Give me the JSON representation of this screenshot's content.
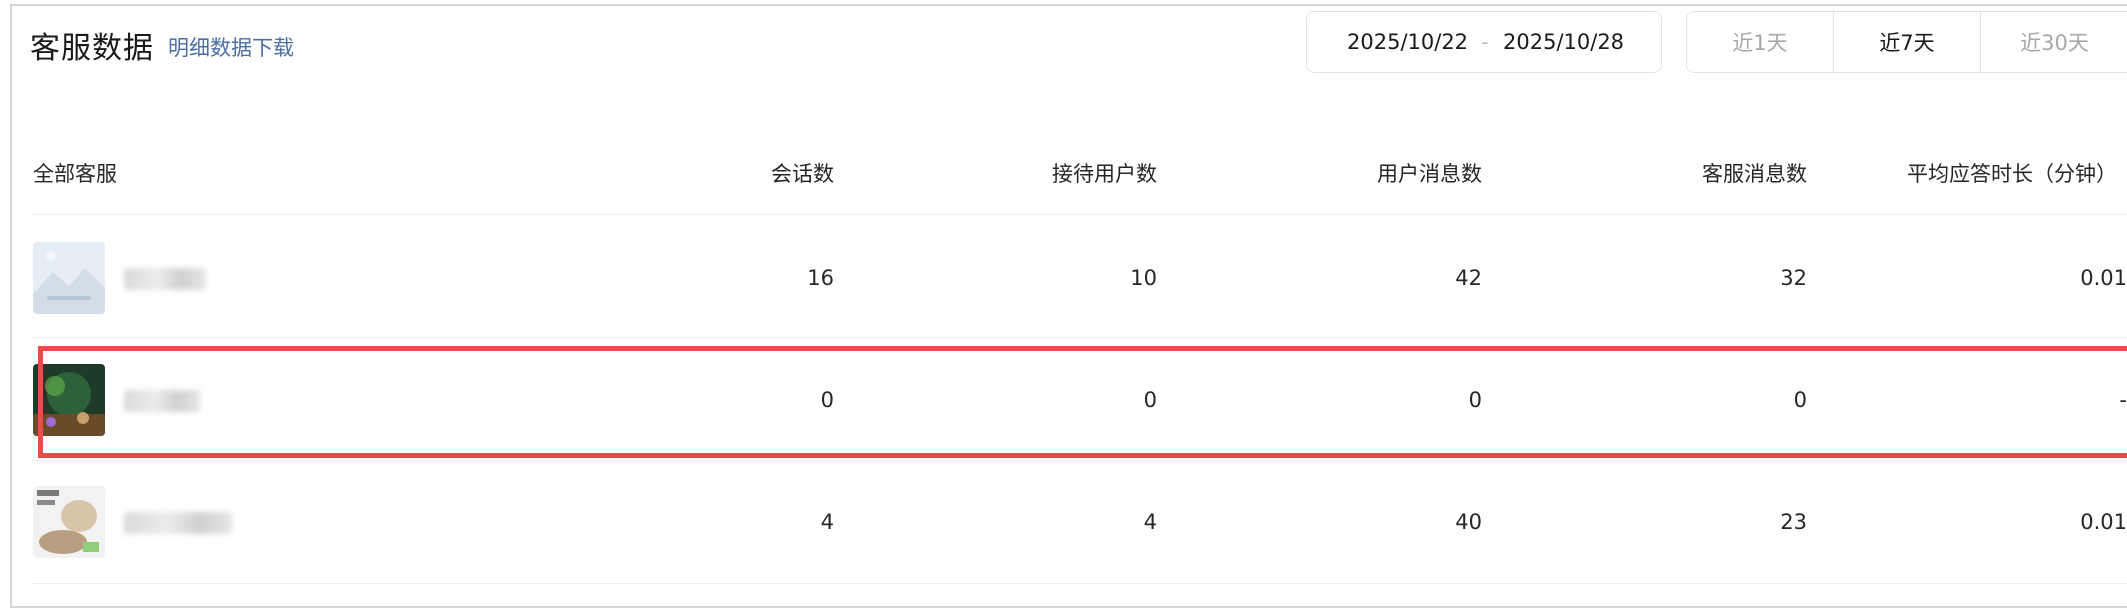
{
  "header": {
    "title": "客服数据",
    "download_link": "明细数据下载"
  },
  "date_range": {
    "start": "2025/10/22",
    "separator": "-",
    "end": "2025/10/28"
  },
  "period_tabs": [
    {
      "label": "近1天",
      "active": false
    },
    {
      "label": "近7天",
      "active": true
    },
    {
      "label": "近30天",
      "active": false
    }
  ],
  "table": {
    "columns": [
      "全部客服",
      "会话数",
      "接待用户数",
      "用户消息数",
      "客服消息数",
      "平均应答时长（分钟）"
    ],
    "rows": [
      {
        "avatar": "placeholder-image-icon",
        "sessions": "16",
        "users": "10",
        "user_msgs": "42",
        "agent_msgs": "32",
        "avg_response": "0.01"
      },
      {
        "avatar": "forest-scene-avatar",
        "sessions": "0",
        "users": "0",
        "user_msgs": "0",
        "agent_msgs": "0",
        "avg_response": "-"
      },
      {
        "avatar": "cat-photo-avatar",
        "sessions": "4",
        "users": "4",
        "user_msgs": "40",
        "agent_msgs": "23",
        "avg_response": "0.01"
      }
    ]
  },
  "colors": {
    "link": "#4a6fa5",
    "highlight": "#e84c4c",
    "muted": "#a8a8a8"
  }
}
